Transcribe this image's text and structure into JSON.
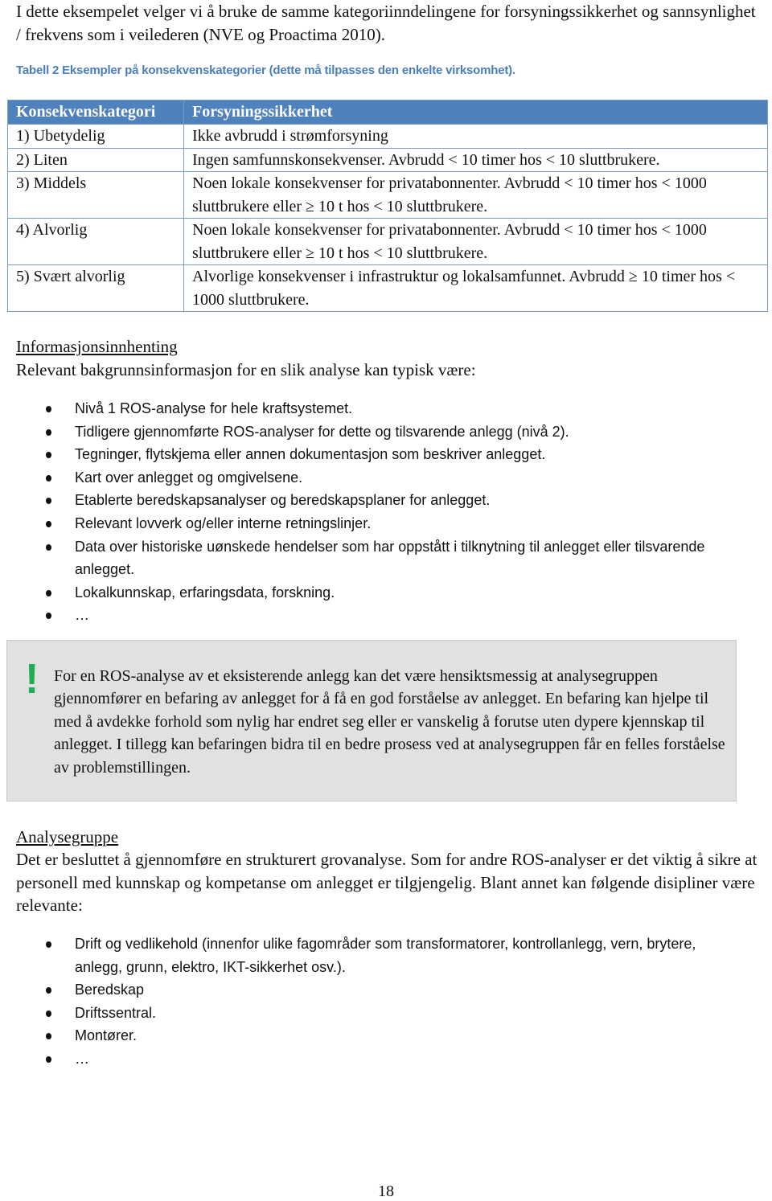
{
  "intro": "I dette eksempelet velger vi å bruke de samme kategoriinndelingene for forsyningssikkerhet og sannsynlighet / frekvens som i veilederen (NVE og Proactima 2010).",
  "table_caption": "Tabell 2 Eksempler på konsekvenskategorier (dette må tilpasses den enkelte virksomhet).",
  "table": {
    "headers": [
      "Konsekvenskategori",
      "Forsyningssikkerhet"
    ],
    "rows": [
      {
        "category": "1) Ubetydelig",
        "description": "Ikke avbrudd i strømforsyning"
      },
      {
        "category": "2) Liten",
        "description": "Ingen samfunnskonsekvenser. Avbrudd < 10 timer hos < 10 sluttbrukere."
      },
      {
        "category": "3) Middels",
        "description": "Noen lokale konsekvenser for privatabonnenter. Avbrudd < 10 timer hos < 1000 sluttbrukere eller ≥ 10 t hos < 10 sluttbrukere."
      },
      {
        "category": "4) Alvorlig",
        "description": "Noen lokale konsekvenser for privatabonnenter. Avbrudd < 10 timer hos < 1000 sluttbrukere eller ≥ 10 t hos < 10 sluttbrukere."
      },
      {
        "category": "5) Svært alvorlig",
        "description": "Alvorlige konsekvenser i infrastruktur og lokalsamfunnet. Avbrudd ≥ 10 timer hos < 1000 sluttbrukere."
      }
    ]
  },
  "info_section": {
    "heading": "Informasjonsinnhenting",
    "lead": "Relevant bakgrunnsinformasjon for en slik analyse kan typisk være:",
    "items": [
      "Nivå 1 ROS-analyse for hele kraftsystemet.",
      "Tidligere gjennomførte ROS-analyser for dette og tilsvarende anlegg (nivå 2).",
      "Tegninger, flytskjema eller annen dokumentasjon som beskriver anlegget.",
      "Kart over anlegget og omgivelsene.",
      "Etablerte beredskapsanalyser og beredskapsplaner for anlegget.",
      "Relevant lovverk og/eller interne retningslinjer.",
      "Data over historiske uønskede hendelser som har oppstått i tilknytning til anlegget eller tilsvarende anlegget.",
      "Lokalkunnskap, erfaringsdata, forskning.",
      "…"
    ]
  },
  "callout": {
    "icon": "exclamation-icon",
    "icon_glyph": "!",
    "icon_color": "#1fae54",
    "text": "For en ROS-analyse av et eksisterende anlegg kan det være hensiktsmessig at analysegruppen gjennomfører en befaring av anlegget for å få en god forståelse av anlegget. En befaring kan hjelpe til med å avdekke forhold som nylig har endret seg eller er vanskelig å forutse uten dypere kjennskap til anlegget. I tillegg kan befaringen bidra til en bedre prosess ved at analysegruppen får en felles forståelse av problemstillingen."
  },
  "ana_section": {
    "heading": "Analysegruppe",
    "text": "Det er besluttet å gjennomføre en strukturert grovanalyse. Som for andre ROS-analyser er det viktig å sikre at personell med kunnskap og kompetanse om anlegget er tilgjengelig. Blant annet kan følgende disipliner være relevante:",
    "items": [
      "Drift og vedlikehold (innenfor ulike fagområder som transformatorer, kontrollanlegg, vern, brytere, anlegg, grunn, elektro, IKT-sikkerhet osv.).",
      "Beredskap",
      "Driftssentral.",
      "Montører.",
      "…"
    ]
  },
  "colors": {
    "table_header_bg": "#4f81bd",
    "caption": "#4a7ebb",
    "callout_bg": "#e1e1e1"
  },
  "page_number": "18"
}
